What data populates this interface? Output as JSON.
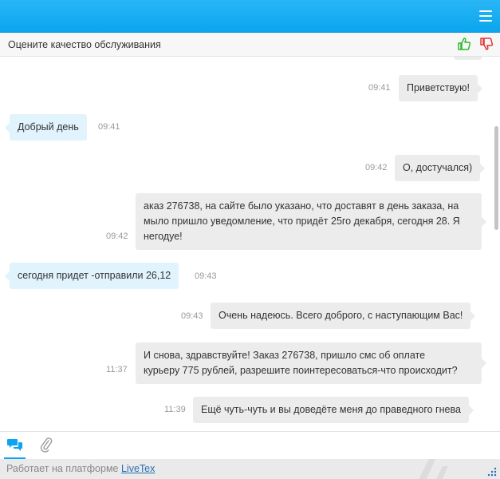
{
  "rate_bar": {
    "text": "Оцените качество обслуживания"
  },
  "messages": [
    {
      "from": "me",
      "text": "Приветствую!",
      "time": "09:41"
    },
    {
      "from": "op",
      "text": "Добрый день",
      "time": "09:41"
    },
    {
      "from": "me",
      "text": "О, достучался)",
      "time": "09:42"
    },
    {
      "from": "me",
      "lines": [
        "аказ 276738, на сайте было указано, что доставят в день заказа, на",
        "мыло пришло уведомление, что придёт 25го декабря, сегодня 28. Я",
        "негодуе!"
      ],
      "time": "09:42"
    },
    {
      "from": "op",
      "text": "сегодня придет -отправили 26,12",
      "time": "09:43"
    },
    {
      "from": "me",
      "text": "Очень надеюсь. Всего доброго, с наступающим Вас!",
      "time": "09:43"
    },
    {
      "from": "me",
      "lines": [
        "И снова, здравствуйте! Заказ 276738, пришло смс об оплате",
        "курьеру 775 рублей, разрешите поинтересоваться-что происходит?"
      ],
      "time": "11:37"
    },
    {
      "from": "me",
      "text": "Ещё чуть-чуть и вы доведёте меня до праведного гнева",
      "time": "11:39"
    }
  ],
  "footer": {
    "prefix": "Работает на платформе ",
    "link": "LiveTex"
  },
  "colors": {
    "header": "#0aa5ee",
    "operator_bubble": "#e1f3fd",
    "user_bubble": "#ececec",
    "accent": "#0aa5ee",
    "like": "#2eb82e",
    "dislike": "#e03535"
  },
  "icons": {
    "menu": "hamburger-menu-icon",
    "like": "thumbs-up-icon",
    "dislike": "thumbs-down-icon",
    "chat": "chat-bubbles-icon",
    "attach": "paperclip-icon"
  }
}
